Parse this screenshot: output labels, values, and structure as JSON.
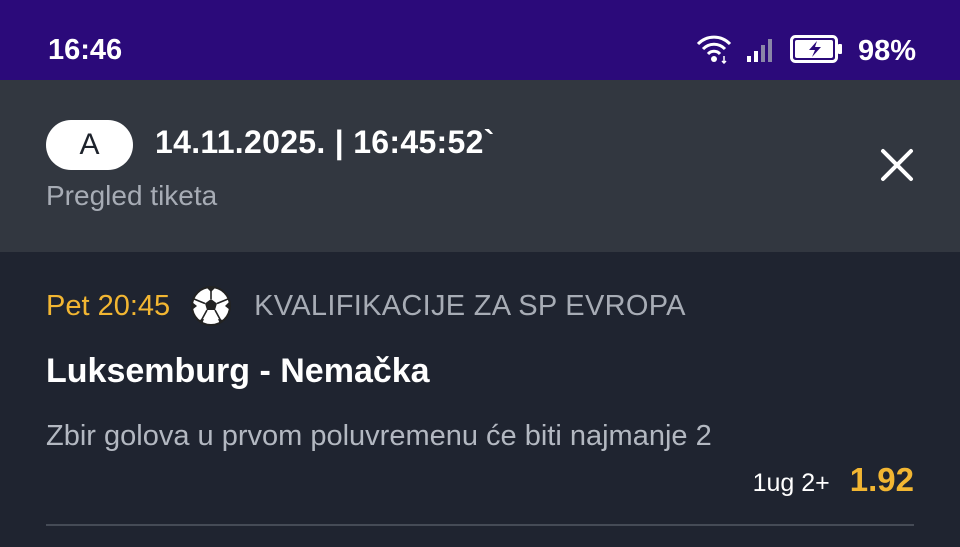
{
  "status_bar": {
    "time": "16:46",
    "battery_percent": "98%",
    "icons": [
      "wifi-icon",
      "signal-icon",
      "battery-charging-icon"
    ],
    "background": "#2b0a7a"
  },
  "header": {
    "badge": "A",
    "datetime": "14.11.2025. | 16:45:52`",
    "subtitle": "Pregled tiketa",
    "close_icon": "close-icon"
  },
  "bet": {
    "kickoff": "Pet 20:45",
    "sport_icon": "soccer-ball-icon",
    "league": "KVALIFIKACIJE ZA SP EVROPA",
    "match": "Luksemburg - Nemačka",
    "market": "Zbir golova u prvom poluvremenu će biti najmanje 2",
    "pick": "1ug 2+",
    "odds": "1.92"
  },
  "colors": {
    "accent_yellow": "#f2b632",
    "header_bg": "#323740",
    "card_bg": "#1f2430"
  }
}
